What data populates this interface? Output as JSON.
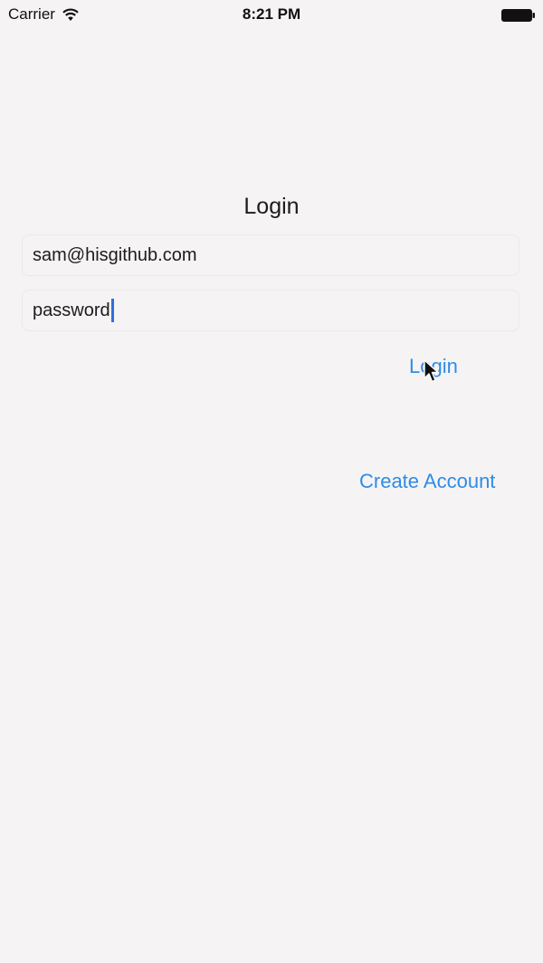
{
  "status_bar": {
    "carrier": "Carrier",
    "time": "8:21 PM"
  },
  "login_form": {
    "title": "Login",
    "email_value": "sam@hisgithub.com",
    "password_value": "password",
    "login_label": "Login",
    "create_account_label": "Create Account"
  },
  "colors": {
    "background": "#f5f3f4",
    "link": "#2f8ce6",
    "caret": "#2f6fe0"
  },
  "icons": [
    "wifi-icon",
    "battery-icon",
    "mouse-cursor-icon"
  ]
}
